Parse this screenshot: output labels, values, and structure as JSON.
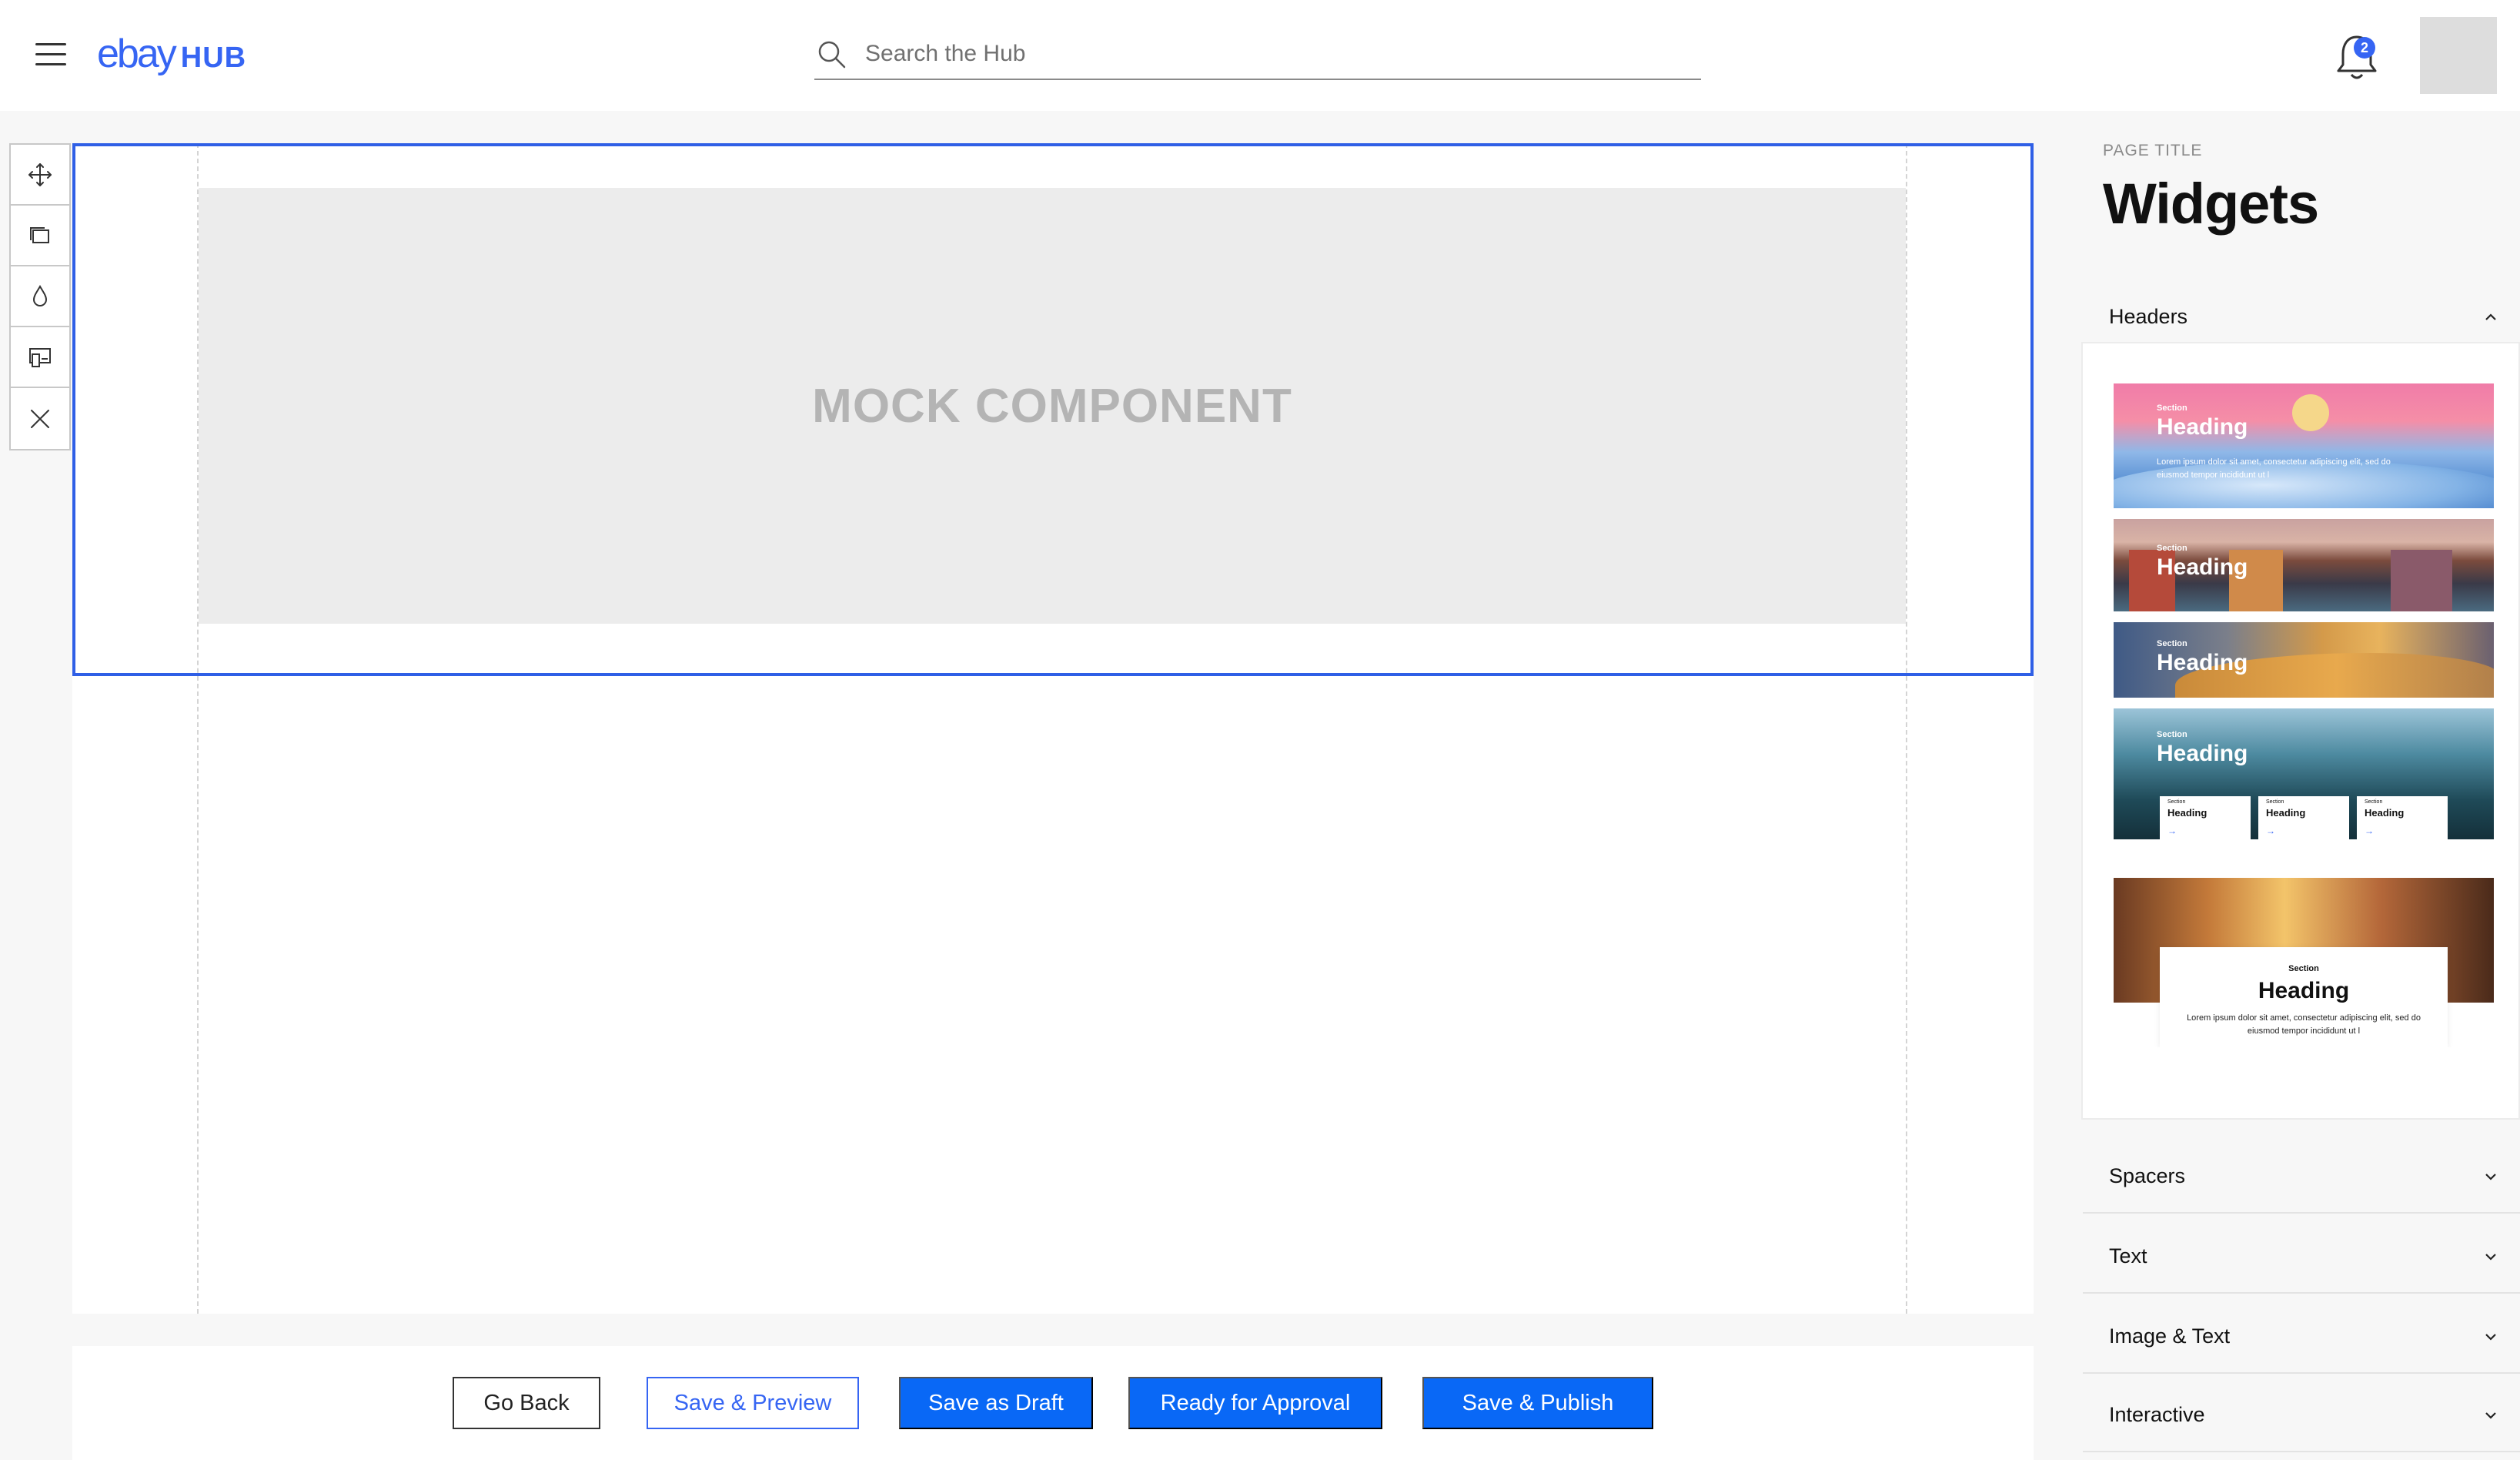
{
  "header": {
    "logo_main": "ebay",
    "logo_sub": "HUB",
    "search_placeholder": "Search the Hub",
    "notification_count": "2"
  },
  "tools": [
    "move-icon",
    "layers-icon",
    "color-drop-icon",
    "devices-icon",
    "close-icon"
  ],
  "canvas": {
    "mock_label": "MOCK COMPONENT"
  },
  "actions": {
    "go_back": "Go Back",
    "save_preview": "Save & Preview",
    "save_draft": "Save as Draft",
    "ready_approval": "Ready for Approval",
    "save_publish": "Save & Publish"
  },
  "panel": {
    "kicker": "PAGE TITLE",
    "title": "Widgets",
    "sections": {
      "headers": "Headers",
      "spacers": "Spacers",
      "text": "Text",
      "image_text": "Image & Text",
      "interactive": "Interactive"
    },
    "thumbnails": {
      "section": "Section",
      "heading": "Heading",
      "lorem": "Lorem ipsum dolor sit amet, consectetur adipiscing elit, sed do eiusmod tempor incididunt ut l",
      "arrow": "→"
    }
  },
  "colors": {
    "brand_blue": "#3665f3",
    "primary_button": "#0968f6",
    "selection_border": "#2f5fe6"
  }
}
